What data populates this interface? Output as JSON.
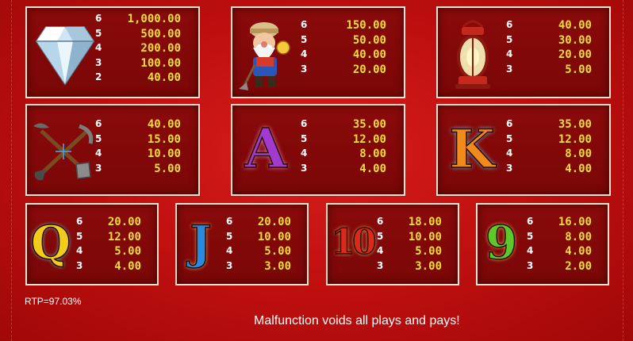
{
  "paytable": {
    "diamond": {
      "symbol": "diamond",
      "pays": [
        {
          "count": "6",
          "value": "1,000.00"
        },
        {
          "count": "5",
          "value": "500.00"
        },
        {
          "count": "4",
          "value": "200.00"
        },
        {
          "count": "3",
          "value": "100.00"
        },
        {
          "count": "2",
          "value": "40.00"
        }
      ]
    },
    "miner": {
      "symbol": "miner",
      "pays": [
        {
          "count": "6",
          "value": "150.00"
        },
        {
          "count": "5",
          "value": "50.00"
        },
        {
          "count": "4",
          "value": "40.00"
        },
        {
          "count": "3",
          "value": "20.00"
        }
      ]
    },
    "lantern": {
      "symbol": "lantern",
      "pays": [
        {
          "count": "6",
          "value": "40.00"
        },
        {
          "count": "5",
          "value": "30.00"
        },
        {
          "count": "4",
          "value": "20.00"
        },
        {
          "count": "3",
          "value": "5.00"
        }
      ]
    },
    "pickaxe": {
      "symbol": "pickaxe-and-shovel",
      "pays": [
        {
          "count": "6",
          "value": "40.00"
        },
        {
          "count": "5",
          "value": "15.00"
        },
        {
          "count": "4",
          "value": "10.00"
        },
        {
          "count": "3",
          "value": "5.00"
        }
      ]
    },
    "ace": {
      "symbol": "A",
      "pays": [
        {
          "count": "6",
          "value": "35.00"
        },
        {
          "count": "5",
          "value": "12.00"
        },
        {
          "count": "4",
          "value": "8.00"
        },
        {
          "count": "3",
          "value": "4.00"
        }
      ]
    },
    "king": {
      "symbol": "K",
      "pays": [
        {
          "count": "6",
          "value": "35.00"
        },
        {
          "count": "5",
          "value": "12.00"
        },
        {
          "count": "4",
          "value": "8.00"
        },
        {
          "count": "3",
          "value": "4.00"
        }
      ]
    },
    "queen": {
      "symbol": "Q",
      "pays": [
        {
          "count": "6",
          "value": "20.00"
        },
        {
          "count": "5",
          "value": "12.00"
        },
        {
          "count": "4",
          "value": "5.00"
        },
        {
          "count": "3",
          "value": "4.00"
        }
      ]
    },
    "jack": {
      "symbol": "J",
      "pays": [
        {
          "count": "6",
          "value": "20.00"
        },
        {
          "count": "5",
          "value": "10.00"
        },
        {
          "count": "4",
          "value": "5.00"
        },
        {
          "count": "3",
          "value": "3.00"
        }
      ]
    },
    "ten": {
      "symbol": "10",
      "pays": [
        {
          "count": "6",
          "value": "18.00"
        },
        {
          "count": "5",
          "value": "10.00"
        },
        {
          "count": "4",
          "value": "5.00"
        },
        {
          "count": "3",
          "value": "3.00"
        }
      ]
    },
    "nine": {
      "symbol": "9",
      "pays": [
        {
          "count": "6",
          "value": "16.00"
        },
        {
          "count": "5",
          "value": "8.00"
        },
        {
          "count": "4",
          "value": "4.00"
        },
        {
          "count": "3",
          "value": "2.00"
        }
      ]
    }
  },
  "footer": {
    "rtp": "RTP=97.03%",
    "disclaimer": "Malfunction voids all plays and pays!"
  },
  "colors": {
    "background": "#c21010",
    "panel": "#7a0707",
    "payout": "#ffd640",
    "count": "#ffffff"
  }
}
